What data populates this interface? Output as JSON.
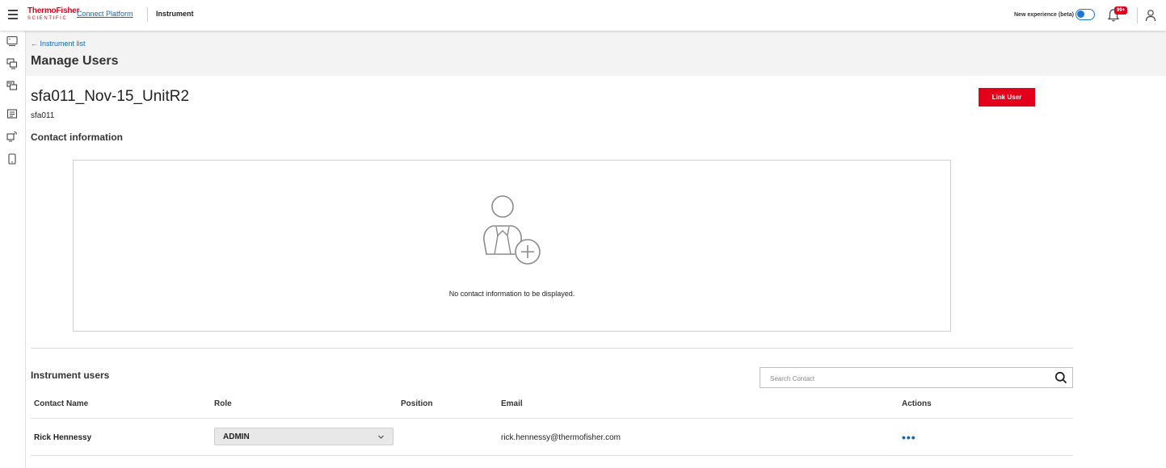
{
  "header": {
    "logo_line1": "ThermoFisher",
    "logo_line2": "SCIENTIFIC",
    "breadcrumb_link": "Connect Platform",
    "breadcrumb_current": "Instrument",
    "beta_label": "New experience (beta)",
    "notification_badge": "99+",
    "beta_enabled": true
  },
  "page": {
    "back_link": "← Instrument list",
    "title": "Manage Users",
    "instrument_name": "sfa011_Nov-15_UnitR2",
    "instrument_id": "sfa011",
    "contact_heading": "Contact information",
    "link_user_label": "Link User",
    "empty_message": "No contact information to be displayed."
  },
  "users": {
    "heading": "Instrument users",
    "search_placeholder": "Search Contact",
    "columns": [
      "Contact Name",
      "Role",
      "Position",
      "Email",
      "Actions"
    ],
    "rows": [
      {
        "name": "Rick Hennessy",
        "role": "ADMIN",
        "position": "",
        "email": "rick.hennessy@thermofisher.com",
        "actions": "•••"
      }
    ]
  },
  "colors": {
    "brand_red": "#e3001b",
    "link_blue": "#1565c0",
    "toggle_blue": "#1976d2"
  }
}
